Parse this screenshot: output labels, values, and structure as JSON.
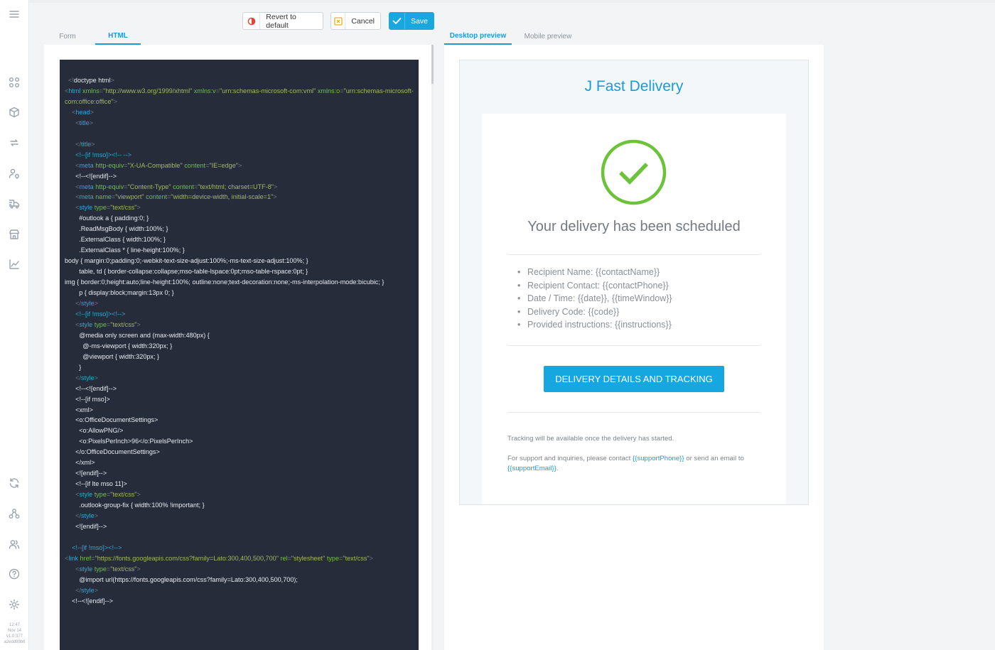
{
  "toolbar": {
    "revert_label": "Revert to default",
    "cancel_label": "Cancel",
    "save_label": "Save"
  },
  "editor_tabs": {
    "form": "Form",
    "html": "HTML"
  },
  "preview_tabs": {
    "desktop": "Desktop preview",
    "mobile": "Mobile preview"
  },
  "sidebar": {
    "icons": [
      "menu-icon",
      "apps-icon",
      "package-icon",
      "repeat-icon",
      "user-location-icon",
      "delivery-icon",
      "store-icon",
      "chart-icon",
      "sync-icon",
      "network-icon",
      "users-icon",
      "help-icon",
      "gear-icon"
    ],
    "footer": {
      "time": "12:47",
      "date": "Nov 14",
      "version": "v1.0.377",
      "build": "a2edd99b6"
    }
  },
  "code_lines": [
    "  <!doctype html>",
    "  <html xmlns=\"http://www.w3.org/1999/xhtml\" xmlns:v=\"urn:schemas-microsoft-com:vml\" xmlns:o=\"urn:schemas-microsoft-com:office:office\">",
    "    <head>",
    "      <title>",
    "",
    "      </title>",
    "      <!--[if !mso]><!-- -->",
    "      <meta http-equiv=\"X-UA-Compatible\" content=\"IE=edge\">",
    "      <!--<![endif]-->",
    "      <meta http-equiv=\"Content-Type\" content=\"text/html; charset=UTF-8\">",
    "      <meta name=\"viewport\" content=\"width=device-width, initial-scale=1\">",
    "      <style type=\"text/css\">",
    "        #outlook a { padding:0; }",
    "        .ReadMsgBody { width:100%; }",
    "        .ExternalClass { width:100%; }",
    "        .ExternalClass * { line-height:100%; }",
    "        body { margin:0;padding:0;-webkit-text-size-adjust:100%;-ms-text-size-adjust:100%; }",
    "        table, td { border-collapse:collapse;mso-table-lspace:0pt;mso-table-rspace:0pt; }",
    "        img { border:0;height:auto;line-height:100%; outline:none;text-decoration:none;-ms-interpolation-mode:bicubic; }",
    "        p { display:block;margin:13px 0; }",
    "      </style>",
    "      <!--[if !mso]><!-->",
    "      <style type=\"text/css\">",
    "        @media only screen and (max-width:480px) {",
    "          @-ms-viewport { width:320px; }",
    "          @viewport { width:320px; }",
    "        }",
    "      </style>",
    "      <!--<![endif]-->",
    "      <!--[if mso]>",
    "      <xml>",
    "      <o:OfficeDocumentSettings>",
    "        <o:AllowPNG/>",
    "        <o:PixelsPerInch>96</o:PixelsPerInch>",
    "      </o:OfficeDocumentSettings>",
    "      </xml>",
    "      <![endif]-->",
    "      <!--[if lte mso 11]>",
    "      <style type=\"text/css\">",
    "        .outlook-group-fix { width:100% !important; }",
    "      </style>",
    "      <![endif]-->",
    "",
    "    <!--[if !mso]><!-->",
    "      <link href=\"https://fonts.googleapis.com/css?family=Lato:300,400,500,700\" rel=\"stylesheet\" type=\"text/css\">",
    "      <style type=\"text/css\">",
    "        @import url(https://fonts.googleapis.com/css?family=Lato:300,400,500,700);",
    "      </style>",
    "    <!--<![endif]-->"
  ],
  "email": {
    "brand": "J Fast Delivery",
    "headline": "Your delivery has been scheduled",
    "details": [
      "Recipient Name: {{contactName}}",
      "Recipient Contact: {{contactPhone}}",
      "Date / Time: {{date}}, {{timeWindow}}",
      "Delivery Code: {{code}}",
      "Provided instructions: {{instructions}}"
    ],
    "cta_label": "DELIVERY DETAILS AND TRACKING",
    "tracking_note": "Tracking will be available once the delivery has started.",
    "support_prefix": "For support and inquiries, please contact ",
    "support_phone": "{{supportPhone}}",
    "support_middle": " or send an email to ",
    "support_email": "{{supportEmail}}",
    "support_suffix": "."
  },
  "colors": {
    "accent": "#1a9bd7",
    "success": "#6cc33a",
    "code_bg": "#272c3b"
  }
}
